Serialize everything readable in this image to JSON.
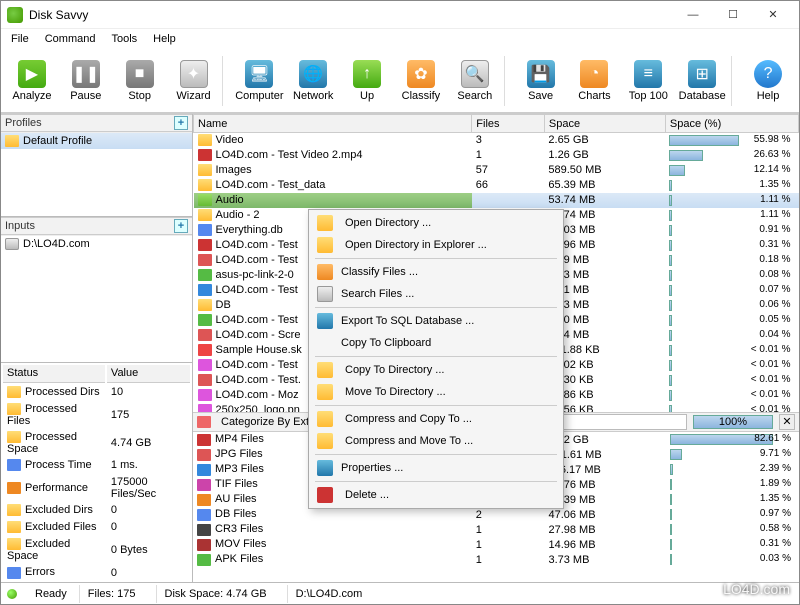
{
  "window": {
    "title": "Disk Savvy"
  },
  "menu": [
    "File",
    "Command",
    "Tools",
    "Help"
  ],
  "toolbar": [
    {
      "label": "Analyze",
      "icon": "ico-green",
      "glyph": "▶"
    },
    {
      "label": "Pause",
      "icon": "ico-gray",
      "glyph": "❚❚"
    },
    {
      "label": "Stop",
      "icon": "ico-gray",
      "glyph": "■"
    },
    {
      "label": "Wizard",
      "icon": "ico-disk",
      "glyph": "✦"
    },
    {
      "sep": true
    },
    {
      "label": "Computer",
      "icon": "ico-blue",
      "glyph": "🖥"
    },
    {
      "label": "Network",
      "icon": "ico-blue",
      "glyph": "🌐"
    },
    {
      "label": "Up",
      "icon": "ico-up",
      "glyph": "↑"
    },
    {
      "label": "Classify",
      "icon": "ico-orange",
      "glyph": "✿"
    },
    {
      "label": "Search",
      "icon": "ico-disk",
      "glyph": "🔍"
    },
    {
      "sep": true
    },
    {
      "label": "Save",
      "icon": "ico-blue",
      "glyph": "💾"
    },
    {
      "label": "Charts",
      "icon": "ico-orange",
      "glyph": "◔"
    },
    {
      "label": "Top 100",
      "icon": "ico-blue",
      "glyph": "≡"
    },
    {
      "label": "Database",
      "icon": "ico-blue",
      "glyph": "⊞"
    },
    {
      "sep": true
    },
    {
      "label": "Help",
      "icon": "ico-help",
      "glyph": "?"
    }
  ],
  "profiles": {
    "header": "Profiles",
    "items": [
      "Default Profile"
    ]
  },
  "inputs": {
    "header": "Inputs",
    "items": [
      "D:\\LO4D.com"
    ]
  },
  "status": {
    "headers": [
      "Status",
      "Value"
    ],
    "rows": [
      {
        "k": "Processed Dirs",
        "v": "10",
        "ico": "ric-folder"
      },
      {
        "k": "Processed Files",
        "v": "175",
        "ico": "ric-folder"
      },
      {
        "k": "Processed Space",
        "v": "4.74 GB",
        "ico": "ric-folder"
      },
      {
        "k": "Process Time",
        "v": "1 ms.",
        "ico": "ric-db"
      },
      {
        "k": "Performance",
        "v": "175000 Files/Sec",
        "ico": "ric-au"
      },
      {
        "k": "Excluded Dirs",
        "v": "0",
        "ico": "ric-folder"
      },
      {
        "k": "Excluded Files",
        "v": "0",
        "ico": "ric-folder"
      },
      {
        "k": "Excluded Space",
        "v": "0 Bytes",
        "ico": "ric-folder"
      },
      {
        "k": "Errors",
        "v": "0",
        "ico": "ric-db"
      }
    ]
  },
  "files": {
    "headers": [
      "Name",
      "Files",
      "Space",
      "Space (%)"
    ],
    "rows": [
      {
        "name": "Video",
        "files": "3",
        "space": "2.65 GB",
        "pct": 55.98,
        "ico": "ric-folder"
      },
      {
        "name": "LO4D.com - Test Video 2.mp4",
        "files": "1",
        "space": "1.26 GB",
        "pct": 26.63,
        "ico": "ric-mp4"
      },
      {
        "name": "Images",
        "files": "57",
        "space": "589.50 MB",
        "pct": 12.14,
        "ico": "ric-folder"
      },
      {
        "name": "LO4D.com - Test_data",
        "files": "66",
        "space": "65.39 MB",
        "pct": 1.35,
        "ico": "ric-folder"
      },
      {
        "name": "Audio",
        "files": "",
        "space": "53.74 MB",
        "pct": 1.11,
        "ico": "ric-folder-green",
        "sel": true
      },
      {
        "name": "Audio - 2",
        "files": "",
        "space": "53.74 MB",
        "pct": 1.11,
        "ico": "ric-folder"
      },
      {
        "name": "Everything.db",
        "files": "",
        "space": "44.03 MB",
        "pct": 0.91,
        "ico": "ric-db"
      },
      {
        "name": "LO4D.com - Test",
        "files": "",
        "space": "14.96 MB",
        "pct": 0.31,
        "ico": "ric-mp4"
      },
      {
        "name": "LO4D.com - Test",
        "files": "",
        "space": "8.69 MB",
        "pct": 0.18,
        "ico": "ric-jpg"
      },
      {
        "name": "asus-pc-link-2-0",
        "files": "",
        "space": "3.73 MB",
        "pct": 0.08,
        "ico": "ric-apk"
      },
      {
        "name": "LO4D.com - Test",
        "files": "",
        "space": "3.31 MB",
        "pct": 0.07,
        "ico": "ric-mp3"
      },
      {
        "name": "DB",
        "files": "",
        "space": "3.03 MB",
        "pct": 0.06,
        "ico": "ric-folder"
      },
      {
        "name": "LO4D.com - Test",
        "files": "",
        "space": "2.20 MB",
        "pct": 0.05,
        "ico": "ric-apk"
      },
      {
        "name": "LO4D.com - Scre",
        "files": "",
        "space": "1.84 MB",
        "pct": 0.04,
        "ico": "ric-jpg"
      },
      {
        "name": "Sample House.sk",
        "files": "",
        "space": "301.88 KB",
        "pct": 0.01,
        "ico": "ric-skp",
        "lt": true
      },
      {
        "name": "LO4D.com - Test",
        "files": "",
        "space": "55.02 KB",
        "pct": 0.01,
        "ico": "ric-png",
        "lt": true
      },
      {
        "name": "LO4D.com - Test.",
        "files": "",
        "space": "54.30 KB",
        "pct": 0.01,
        "ico": "ric-jpg",
        "lt": true
      },
      {
        "name": "LO4D.com - Moz",
        "files": "",
        "space": "51.86 KB",
        "pct": 0.01,
        "ico": "ric-png",
        "lt": true
      },
      {
        "name": "250x250_logo.pn",
        "files": "",
        "space": "21.56 KB",
        "pct": 0.01,
        "ico": "ric-png",
        "lt": true
      },
      {
        "name": "LO4D.com - Test",
        "files": "",
        "space": "13.68 KB",
        "pct": 0.01,
        "ico": "ric-jpg",
        "lt": true
      }
    ]
  },
  "catbar": {
    "label": "Categorize By Ext",
    "dd": "egories",
    "pct": "100%"
  },
  "cats": {
    "rows": [
      {
        "name": "MP4 Files",
        "files": "",
        "space": "3.92 GB",
        "pct": 82.61,
        "ico": "ric-mp4"
      },
      {
        "name": "JPG Files",
        "files": "",
        "space": "471.61 MB",
        "pct": 9.71,
        "ico": "ric-jpg"
      },
      {
        "name": "MP3 Files",
        "files": "",
        "space": "116.17 MB",
        "pct": 2.39,
        "ico": "ric-mp3"
      },
      {
        "name": "TIF Files",
        "files": "",
        "space": "91.76 MB",
        "pct": 1.89,
        "ico": "ric-tif"
      },
      {
        "name": "AU Files",
        "files": "",
        "space": "65.39 MB",
        "pct": 1.35,
        "ico": "ric-au"
      },
      {
        "name": "DB Files",
        "files": "2",
        "space": "47.06 MB",
        "pct": 0.97,
        "ico": "ric-db"
      },
      {
        "name": "CR3 Files",
        "files": "1",
        "space": "27.98 MB",
        "pct": 0.58,
        "ico": "ric-cr3"
      },
      {
        "name": "MOV Files",
        "files": "1",
        "space": "14.96 MB",
        "pct": 0.31,
        "ico": "ric-mov"
      },
      {
        "name": "APK Files",
        "files": "1",
        "space": "3.73 MB",
        "pct": 0.03,
        "ico": "ric-apk"
      }
    ]
  },
  "contextmenu": [
    {
      "label": "Open Directory ...",
      "ico": "ric-folder"
    },
    {
      "label": "Open Directory in Explorer ...",
      "ico": "ric-folder"
    },
    {
      "sep": true
    },
    {
      "label": "Classify Files ...",
      "ico": "ico-orange"
    },
    {
      "label": "Search Files ...",
      "ico": "ico-disk"
    },
    {
      "sep": true
    },
    {
      "label": "Export To SQL Database ...",
      "ico": "ico-blue"
    },
    {
      "label": "Copy To Clipboard",
      "ico": ""
    },
    {
      "sep": true
    },
    {
      "label": "Copy To Directory ...",
      "ico": "ric-folder"
    },
    {
      "label": "Move To Directory ...",
      "ico": "ric-folder"
    },
    {
      "sep": true
    },
    {
      "label": "Compress and Copy To ...",
      "ico": "ric-folder"
    },
    {
      "label": "Compress and Move To ...",
      "ico": "ric-folder"
    },
    {
      "sep": true
    },
    {
      "label": "Properties ...",
      "ico": "ico-blue"
    },
    {
      "sep": true
    },
    {
      "label": "Delete ...",
      "ico": "ric-mp4"
    }
  ],
  "statusbar": {
    "ready": "Ready",
    "files": "Files: 175",
    "diskspace": "Disk Space: 4.74 GB",
    "path": "D:\\LO4D.com"
  },
  "watermark": "LO4D.com"
}
